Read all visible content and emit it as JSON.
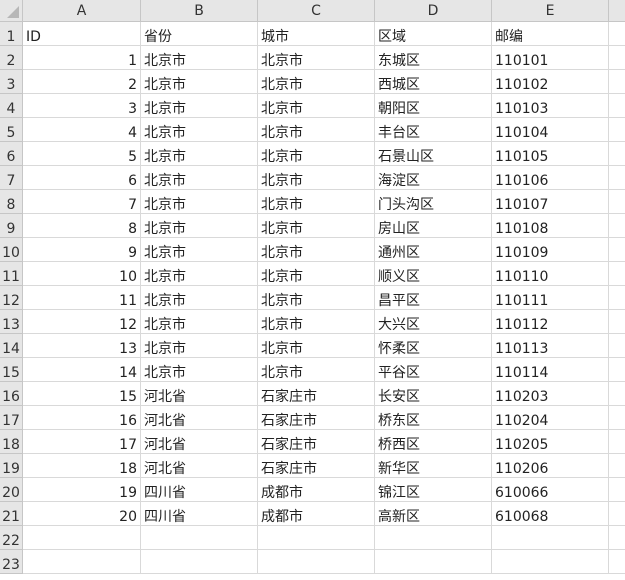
{
  "columns": [
    "A",
    "B",
    "C",
    "D",
    "E"
  ],
  "rows": [
    {
      "row": "1",
      "cells": [
        "ID",
        "省份",
        "城市",
        "区域",
        "邮编"
      ]
    },
    {
      "row": "2",
      "cells": [
        "1",
        "北京市",
        "北京市",
        "东城区",
        "110101"
      ]
    },
    {
      "row": "3",
      "cells": [
        "2",
        "北京市",
        "北京市",
        "西城区",
        "110102"
      ]
    },
    {
      "row": "4",
      "cells": [
        "3",
        "北京市",
        "北京市",
        "朝阳区",
        "110103"
      ]
    },
    {
      "row": "5",
      "cells": [
        "4",
        "北京市",
        "北京市",
        "丰台区",
        "110104"
      ]
    },
    {
      "row": "6",
      "cells": [
        "5",
        "北京市",
        "北京市",
        "石景山区",
        "110105"
      ]
    },
    {
      "row": "7",
      "cells": [
        "6",
        "北京市",
        "北京市",
        "海淀区",
        "110106"
      ]
    },
    {
      "row": "8",
      "cells": [
        "7",
        "北京市",
        "北京市",
        "门头沟区",
        "110107"
      ]
    },
    {
      "row": "9",
      "cells": [
        "8",
        "北京市",
        "北京市",
        "房山区",
        "110108"
      ]
    },
    {
      "row": "10",
      "cells": [
        "9",
        "北京市",
        "北京市",
        "通州区",
        "110109"
      ]
    },
    {
      "row": "11",
      "cells": [
        "10",
        "北京市",
        "北京市",
        "顺义区",
        "110110"
      ]
    },
    {
      "row": "12",
      "cells": [
        "11",
        "北京市",
        "北京市",
        "昌平区",
        "110111"
      ]
    },
    {
      "row": "13",
      "cells": [
        "12",
        "北京市",
        "北京市",
        "大兴区",
        "110112"
      ]
    },
    {
      "row": "14",
      "cells": [
        "13",
        "北京市",
        "北京市",
        "怀柔区",
        "110113"
      ]
    },
    {
      "row": "15",
      "cells": [
        "14",
        "北京市",
        "北京市",
        "平谷区",
        "110114"
      ]
    },
    {
      "row": "16",
      "cells": [
        "15",
        "河北省",
        "石家庄市",
        "长安区",
        "110203"
      ]
    },
    {
      "row": "17",
      "cells": [
        "16",
        "河北省",
        "石家庄市",
        "桥东区",
        "110204"
      ]
    },
    {
      "row": "18",
      "cells": [
        "17",
        "河北省",
        "石家庄市",
        "桥西区",
        "110205"
      ]
    },
    {
      "row": "19",
      "cells": [
        "18",
        "河北省",
        "石家庄市",
        "新华区",
        "110206"
      ]
    },
    {
      "row": "20",
      "cells": [
        "19",
        "四川省",
        "成都市",
        "锦江区",
        "610066"
      ]
    },
    {
      "row": "21",
      "cells": [
        "20",
        "四川省",
        "成都市",
        "高新区",
        "610068"
      ]
    },
    {
      "row": "22",
      "cells": [
        "",
        "",
        "",
        "",
        ""
      ]
    },
    {
      "row": "23",
      "cells": [
        "",
        "",
        "",
        "",
        ""
      ]
    }
  ],
  "colors": {
    "header_bg": "#e6e6e6",
    "gridline": "#d9d9d9",
    "accent": "#217346"
  }
}
